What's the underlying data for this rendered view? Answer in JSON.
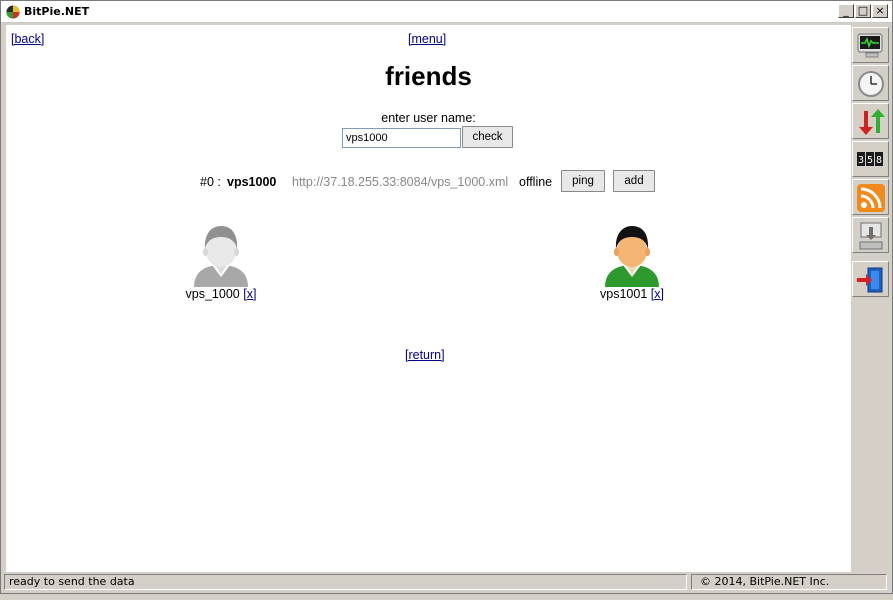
{
  "window": {
    "title": "BitPie.NET",
    "minimize_glyph": "_",
    "maximize_glyph": "□",
    "close_glyph": "×"
  },
  "nav": {
    "back_label": "[back]",
    "menu_label": "[menu]",
    "return_label": "[return]"
  },
  "page": {
    "title": "friends",
    "enter_label": "enter user name:",
    "input_value": "vps1000",
    "check_label": "check"
  },
  "result": {
    "index": "#0 :",
    "name": "vps1000",
    "url": "http://37.18.255.33:8084/vps_1000.xml",
    "status": "offline",
    "ping_label": "ping",
    "add_label": "add"
  },
  "friends": [
    {
      "name": "vps_1000",
      "remove_label": "x",
      "state": "offline",
      "color": "#a8a8a8"
    },
    {
      "name": "vps1001",
      "remove_label": "x",
      "state": "online",
      "color": "#2e9a2e"
    }
  ],
  "sidebar": {
    "icons": [
      "monitor-icon",
      "clock-icon",
      "transfer-arrows-icon",
      "counter-icon",
      "rss-icon",
      "install-icon",
      "exit-door-icon"
    ]
  },
  "statusbar": {
    "message": "ready to send the data",
    "copyright": "© 2014, BitPie.NET Inc."
  },
  "colors": {
    "link": "#00008b",
    "url_gray": "#888888",
    "panel": "#d4d0c8"
  }
}
